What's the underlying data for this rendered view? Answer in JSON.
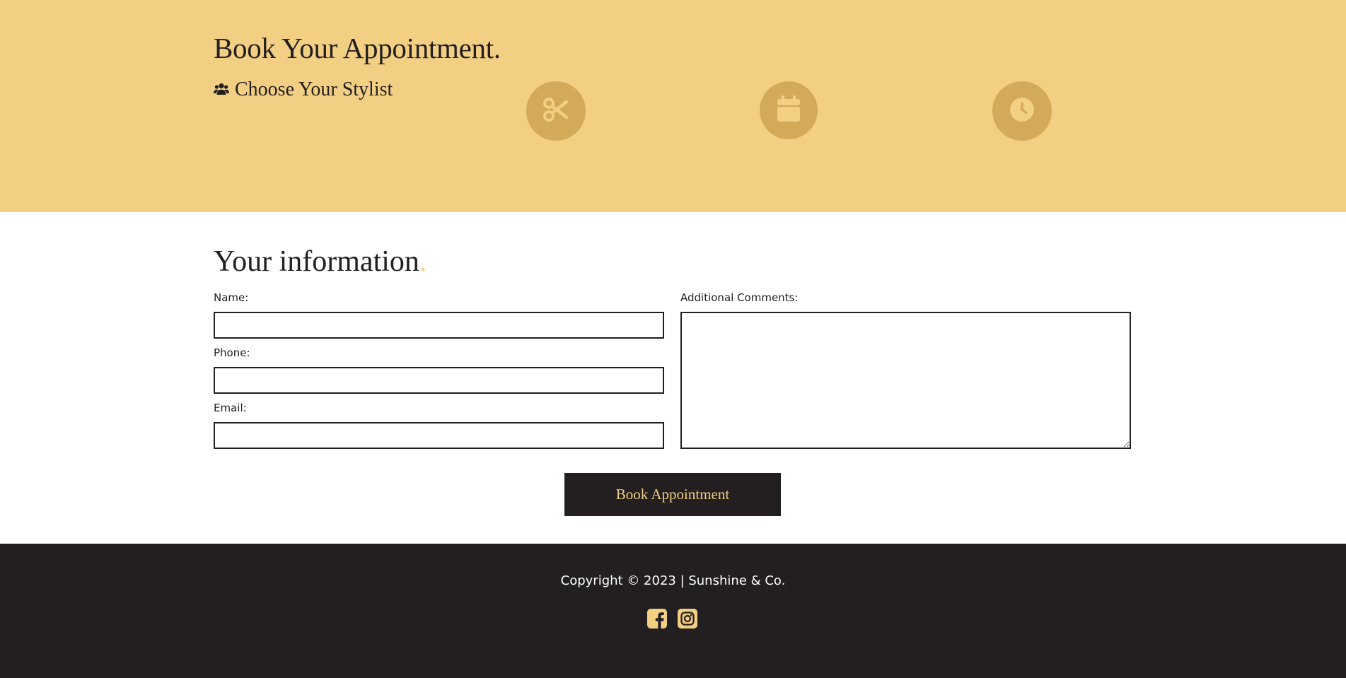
{
  "hero": {
    "title": "Book Your Appointment.",
    "subtitle": "Choose Your Stylist",
    "subtitle_icon": "users-icon",
    "steps": [
      {
        "icon": "scissors-icon"
      },
      {
        "icon": "calendar-icon"
      },
      {
        "icon": "clock-icon"
      }
    ]
  },
  "form": {
    "title": "Your information",
    "title_dot": ".",
    "name_label": "Name:",
    "name_value": "",
    "phone_label": "Phone:",
    "phone_value": "",
    "email_label": "Email:",
    "email_value": "",
    "comments_label": "Additional Comments:",
    "comments_value": "",
    "submit_label": "Book Appointment"
  },
  "footer": {
    "copyright": "Copyright © 2023 | Sunshine & Co.",
    "social": [
      {
        "icon": "facebook-icon"
      },
      {
        "icon": "instagram-icon"
      }
    ]
  },
  "colors": {
    "accent": "#f2cf82",
    "accent_dark": "#d3a95a",
    "dark": "#231f20",
    "background": "#ffffff"
  }
}
